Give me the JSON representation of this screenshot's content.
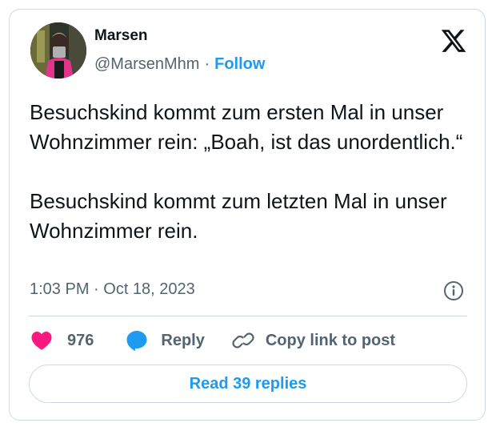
{
  "author": {
    "name": "Marsen",
    "handle": "@MarsenMhm",
    "separator": "·",
    "follow_label": "Follow",
    "avatar_icon": "profile-photo"
  },
  "brand": {
    "logo_icon": "x-logo"
  },
  "post": {
    "paragraphs": [
      "Besuchskind kommt zum ersten Mal in unser Wohnzimmer rein: „Boah, ist das unordentlich.“",
      "Besuchskind kommt zum letzten Mal in unser Wohnzimmer rein."
    ],
    "timestamp": "1:03 PM · Oct 18, 2023",
    "info_icon": "info-icon"
  },
  "actions": {
    "like_count": "976",
    "reply_label": "Reply",
    "copy_label": "Copy link to post"
  },
  "footer": {
    "read_replies_label": "Read 39 replies"
  },
  "colors": {
    "accent": "#1d9bf0",
    "heart": "#f91880",
    "text_primary": "#0f1419",
    "text_secondary": "#536471",
    "border": "#cfd9de"
  }
}
